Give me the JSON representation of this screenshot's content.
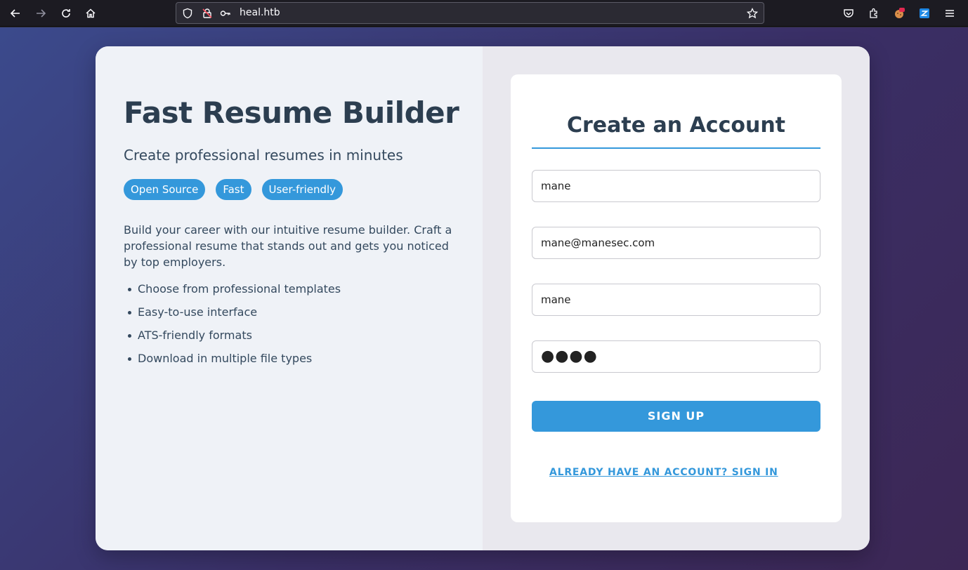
{
  "browser": {
    "url": "heal.htb"
  },
  "hero": {
    "title": "Fast Resume Builder",
    "subtitle": "Create professional resumes in minutes",
    "tags": [
      "Open Source",
      "Fast",
      "User-friendly"
    ],
    "description": "Build your career with our intuitive resume builder. Craft a professional resume that stands out and gets you noticed by top employers.",
    "features": [
      "Choose from professional templates",
      "Easy-to-use interface",
      "ATS-friendly formats",
      "Download in multiple file types"
    ]
  },
  "form": {
    "title": "Create an Account",
    "fields": {
      "fullname": "mane",
      "email": "mane@manesec.com",
      "username": "mane",
      "password": "●●●●"
    },
    "submit_label": "SIGN UP",
    "signin_label": "ALREADY HAVE AN ACCOUNT? SIGN IN"
  },
  "colors": {
    "accent": "#3498db",
    "heading": "#2c3e50"
  }
}
